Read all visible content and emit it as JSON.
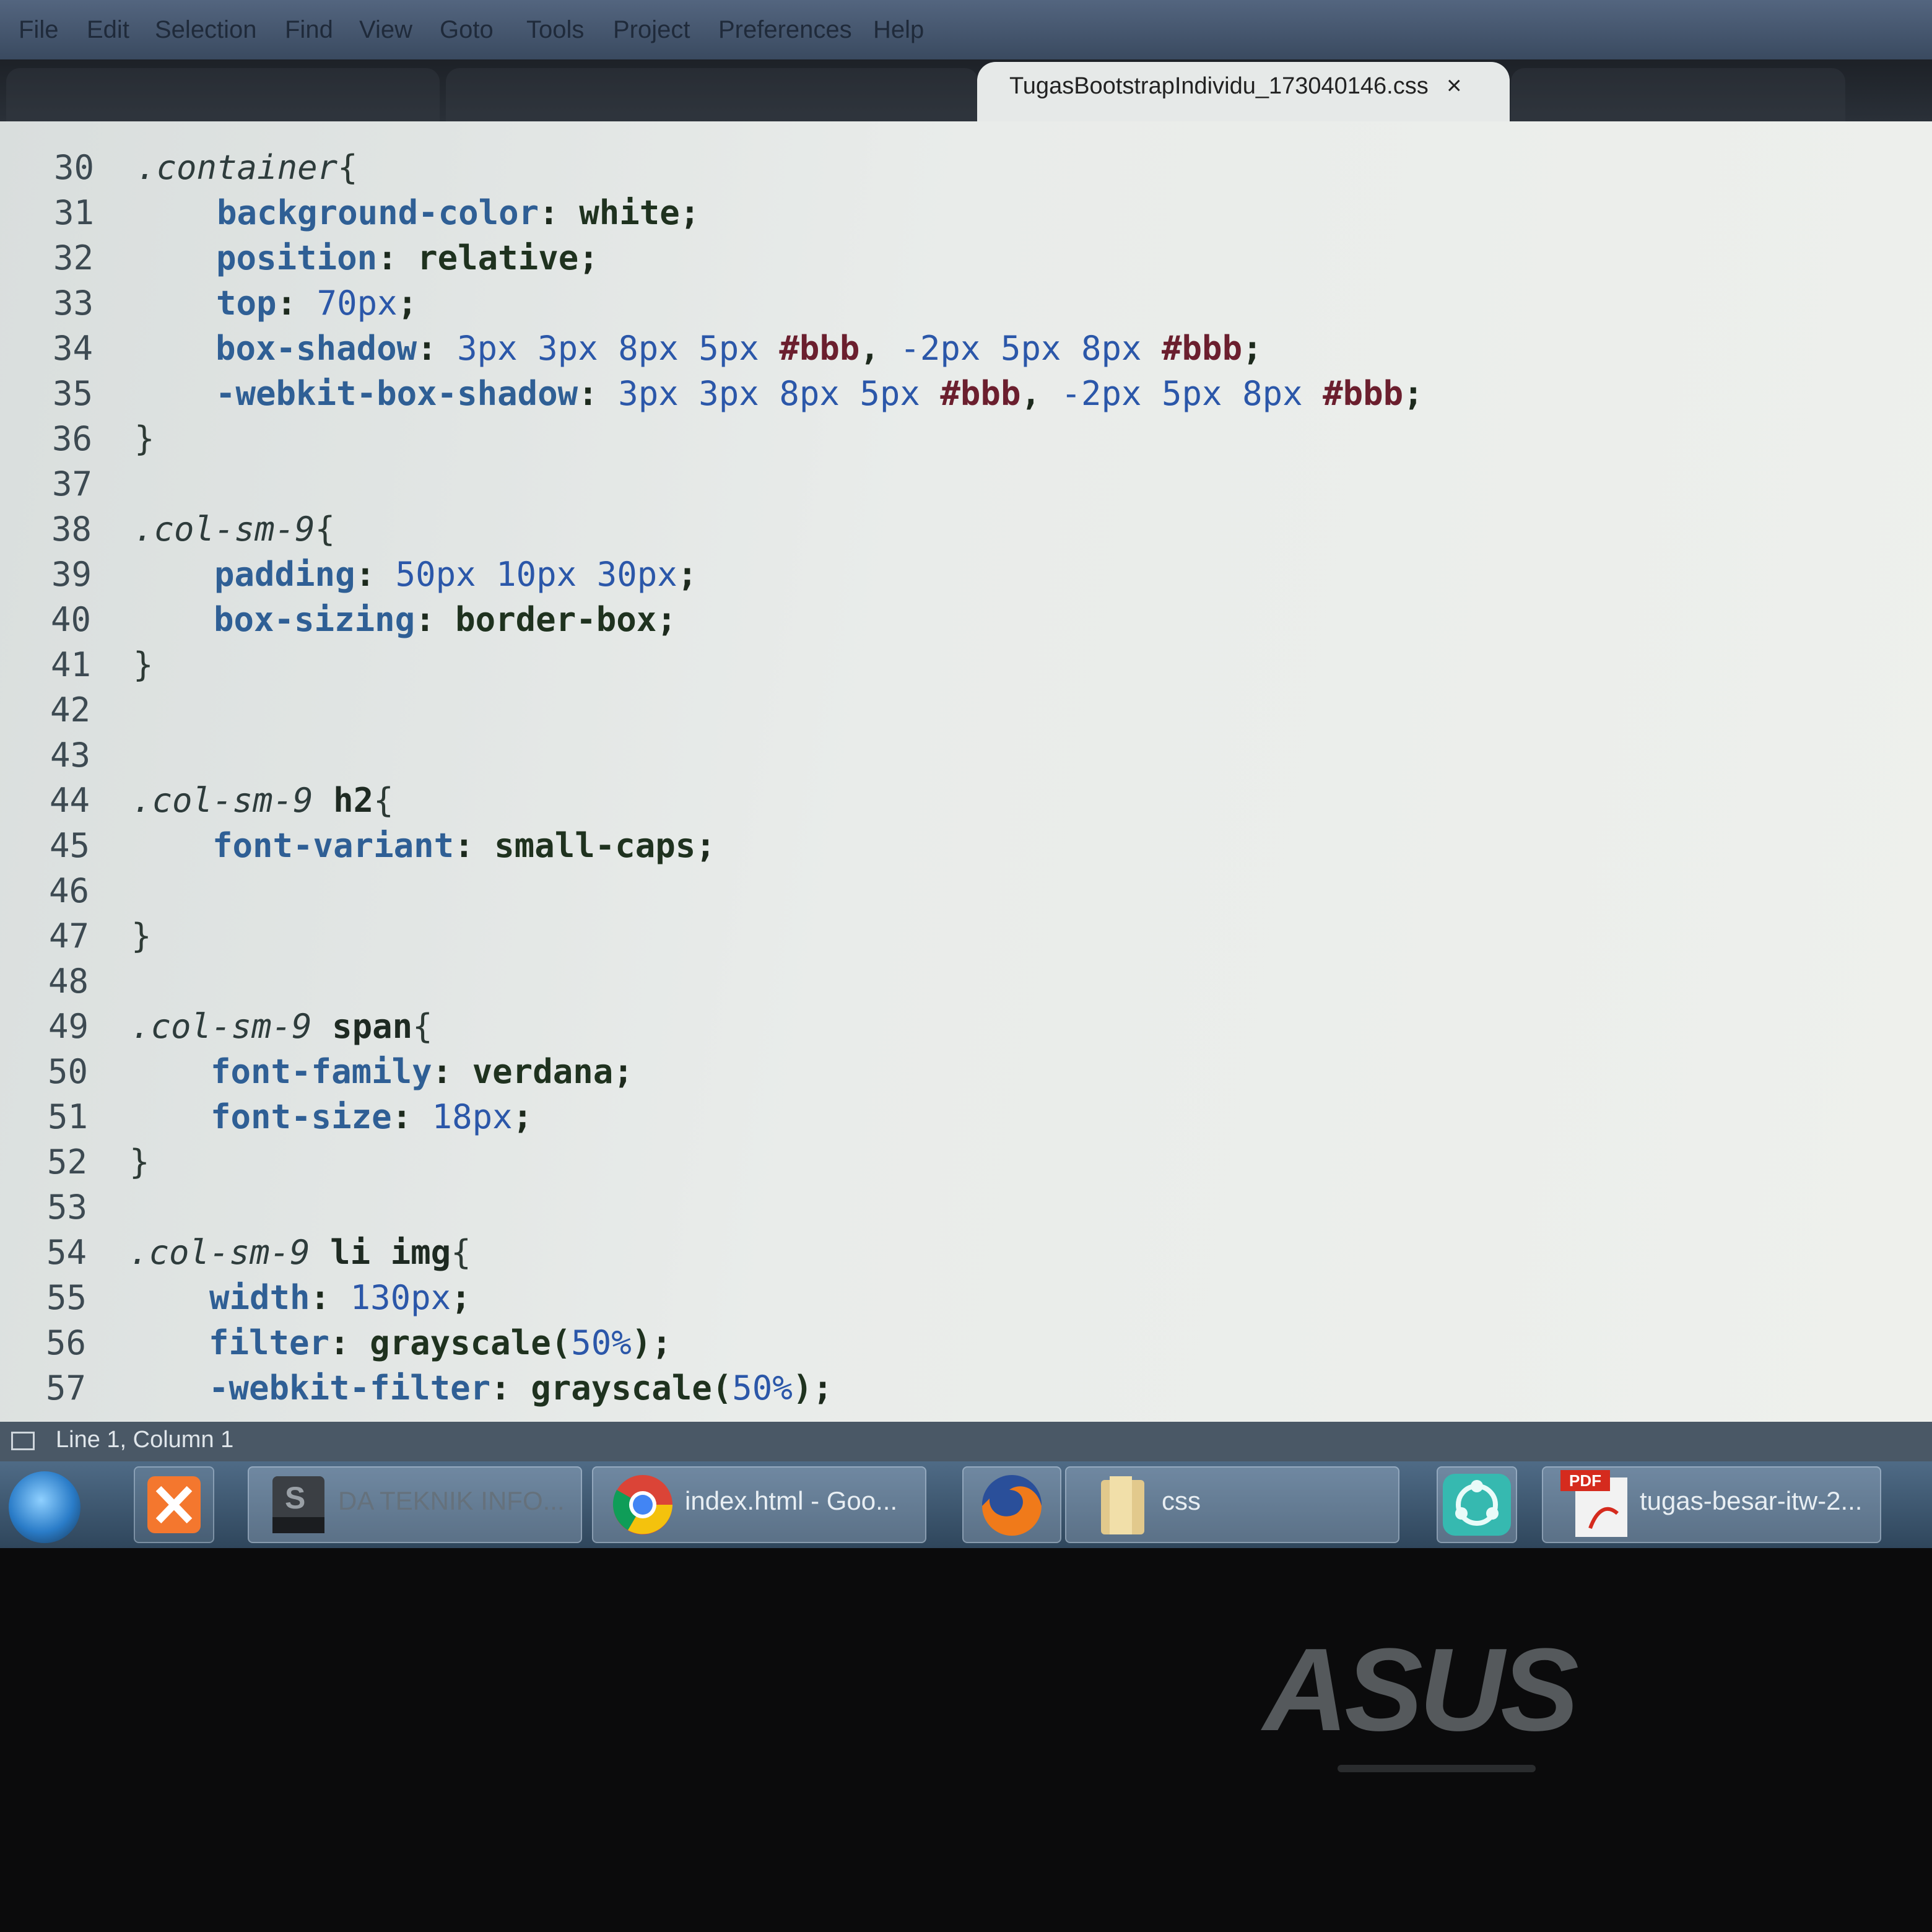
{
  "menu": [
    "File",
    "Edit",
    "Selection",
    "Find",
    "View",
    "Goto",
    "Tools",
    "Project",
    "Preferences",
    "Help"
  ],
  "tab": {
    "title": "TugasBootstrapIndividu_173040146.css",
    "close": "×"
  },
  "editor": {
    "line_numbers": [
      "30",
      "31",
      "32",
      "33",
      "34",
      "35",
      "36",
      "37",
      "38",
      "39",
      "40",
      "41",
      "42",
      "43",
      "44",
      "45",
      "46",
      "47",
      "48",
      "49",
      "50",
      "51",
      "52",
      "53",
      "54",
      "55",
      "56",
      "57"
    ],
    "lines": [
      [
        {
          "t": "sel",
          "v": ".container"
        },
        {
          "t": "brace",
          "v": "{"
        }
      ],
      [
        {
          "t": "prop",
          "v": "background-color"
        },
        {
          "t": "punc",
          "v": ": "
        },
        {
          "t": "val",
          "v": "white"
        },
        {
          "t": "punc",
          "v": ";"
        }
      ],
      [
        {
          "t": "prop",
          "v": "position"
        },
        {
          "t": "punc",
          "v": ": "
        },
        {
          "t": "val",
          "v": "relative"
        },
        {
          "t": "punc",
          "v": ";"
        }
      ],
      [
        {
          "t": "prop",
          "v": "top"
        },
        {
          "t": "punc",
          "v": ": "
        },
        {
          "t": "num",
          "v": "70px"
        },
        {
          "t": "punc",
          "v": ";"
        }
      ],
      [
        {
          "t": "prop",
          "v": "box-shadow"
        },
        {
          "t": "punc",
          "v": ": "
        },
        {
          "t": "num",
          "v": "3px 3px 8px 5px "
        },
        {
          "t": "hex",
          "v": "#bbb"
        },
        {
          "t": "punc",
          "v": ", "
        },
        {
          "t": "num",
          "v": "-2px 5px 8px "
        },
        {
          "t": "hex",
          "v": "#bbb"
        },
        {
          "t": "punc",
          "v": ";"
        }
      ],
      [
        {
          "t": "prop",
          "v": "-webkit-box-shadow"
        },
        {
          "t": "punc",
          "v": ": "
        },
        {
          "t": "num",
          "v": "3px 3px 8px 5px "
        },
        {
          "t": "hex",
          "v": "#bbb"
        },
        {
          "t": "punc",
          "v": ", "
        },
        {
          "t": "num",
          "v": "-2px 5px 8px "
        },
        {
          "t": "hex",
          "v": "#bbb"
        },
        {
          "t": "punc",
          "v": ";"
        }
      ],
      [
        {
          "t": "brace",
          "v": "}"
        }
      ],
      [],
      [
        {
          "t": "sel",
          "v": ".col-sm-9"
        },
        {
          "t": "brace",
          "v": "{"
        }
      ],
      [
        {
          "t": "prop",
          "v": "padding"
        },
        {
          "t": "punc",
          "v": ": "
        },
        {
          "t": "num",
          "v": "50px 10px 30px"
        },
        {
          "t": "punc",
          "v": ";"
        }
      ],
      [
        {
          "t": "prop",
          "v": "box-sizing"
        },
        {
          "t": "punc",
          "v": ": "
        },
        {
          "t": "val",
          "v": "border-box"
        },
        {
          "t": "punc",
          "v": ";"
        }
      ],
      [
        {
          "t": "brace",
          "v": "}"
        }
      ],
      [],
      [],
      [
        {
          "t": "sel",
          "v": ".col-sm-9 "
        },
        {
          "t": "tag",
          "v": "h2"
        },
        {
          "t": "brace",
          "v": "{"
        }
      ],
      [
        {
          "t": "prop",
          "v": "font-variant"
        },
        {
          "t": "punc",
          "v": ": "
        },
        {
          "t": "val",
          "v": "small-caps"
        },
        {
          "t": "punc",
          "v": ";"
        }
      ],
      [],
      [
        {
          "t": "brace",
          "v": "}"
        }
      ],
      [],
      [
        {
          "t": "sel",
          "v": ".col-sm-9 "
        },
        {
          "t": "tag",
          "v": "span"
        },
        {
          "t": "brace",
          "v": "{"
        }
      ],
      [
        {
          "t": "prop",
          "v": "font-family"
        },
        {
          "t": "punc",
          "v": ": "
        },
        {
          "t": "val",
          "v": "verdana"
        },
        {
          "t": "punc",
          "v": ";"
        }
      ],
      [
        {
          "t": "prop",
          "v": "font-size"
        },
        {
          "t": "punc",
          "v": ": "
        },
        {
          "t": "num",
          "v": "18px"
        },
        {
          "t": "punc",
          "v": ";"
        }
      ],
      [
        {
          "t": "brace",
          "v": "}"
        }
      ],
      [],
      [
        {
          "t": "sel",
          "v": ".col-sm-9 "
        },
        {
          "t": "tag",
          "v": "li img"
        },
        {
          "t": "brace",
          "v": "{"
        }
      ],
      [
        {
          "t": "prop",
          "v": "width"
        },
        {
          "t": "punc",
          "v": ": "
        },
        {
          "t": "num",
          "v": "130px"
        },
        {
          "t": "punc",
          "v": ";"
        }
      ],
      [
        {
          "t": "prop",
          "v": "filter"
        },
        {
          "t": "punc",
          "v": ": "
        },
        {
          "t": "val",
          "v": "grayscale("
        },
        {
          "t": "num",
          "v": "50%"
        },
        {
          "t": "val",
          "v": ")"
        },
        {
          "t": "punc",
          "v": ";"
        }
      ],
      [
        {
          "t": "prop",
          "v": "-webkit-filter"
        },
        {
          "t": "punc",
          "v": ": "
        },
        {
          "t": "val",
          "v": "grayscale("
        },
        {
          "t": "num",
          "v": "50%"
        },
        {
          "t": "val",
          "v": ")"
        },
        {
          "t": "punc",
          "v": ";"
        }
      ]
    ]
  },
  "status": {
    "text": "Line 1, Column 1"
  },
  "taskbar": {
    "items": [
      {
        "label": "",
        "icon": "xampp-icon"
      },
      {
        "label": "DA TEKNIK INFO...",
        "icon": "sublime-text-icon"
      },
      {
        "label": "index.html - Goo...",
        "icon": "chrome-icon"
      },
      {
        "label": "",
        "icon": "firefox-icon"
      },
      {
        "label": "css",
        "icon": "folder-icon"
      },
      {
        "label": "",
        "icon": "shareit-icon"
      },
      {
        "label": "tugas-besar-itw-2...",
        "icon": "pdf-icon",
        "badge": "PDF"
      }
    ]
  },
  "bezel": {
    "brand": "ASUS"
  }
}
